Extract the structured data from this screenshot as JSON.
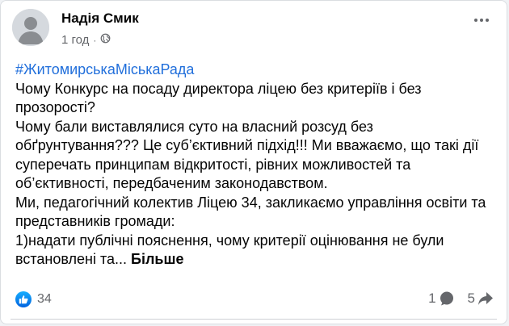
{
  "post": {
    "author": "Надія Смик",
    "time": "1 год",
    "separator": "·",
    "hashtag": "#ЖитомирськаМіськаРада",
    "paragraphs": [
      "Чому Конкурс на посаду директора ліцею без критеріїв і без прозорості?",
      "Чому бали виставлялися суто на власний розсуд без обґрунтування??? Це  суб’єктивний підхід!!! Ми вважаємо, що такі дії суперечать принципам відкритості, рівних можливостей та об’єктивності, передбаченим законодавством.",
      "Ми, педагогічний колектив Ліцею 34, закликаємо управління освіти та представників громади:",
      "1)надати публічні пояснення, чому критерії оцінювання не були встановлені та..."
    ],
    "see_more": "Більше"
  },
  "footer": {
    "reactions_count": "34",
    "comments_count": "1",
    "shares_count": "5"
  },
  "icons": {
    "audience": "globe-icon",
    "reaction": "like-icon",
    "comments": "comment-icon",
    "shares": "share-icon"
  },
  "colors": {
    "hashtag": "#216fdb",
    "like_badge": "#1877f2",
    "secondary_text": "#65676b"
  }
}
